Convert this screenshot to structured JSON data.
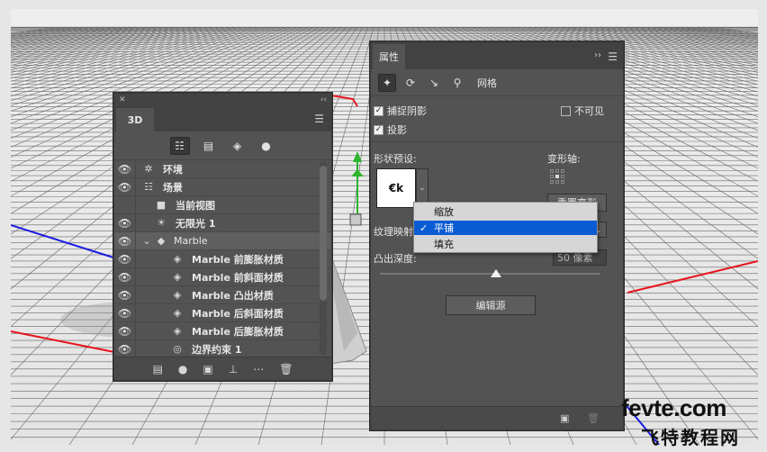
{
  "colors": {
    "panel_bg": "#535353",
    "selection_blue": "#0b5bd3",
    "axis_red": "#e8141c",
    "axis_blue": "#1a1ae0",
    "gizmo_green": "#2db52d"
  },
  "panel_3d": {
    "tab_label": "3D",
    "filter_icons": [
      "scene-filter-icon",
      "mesh-filter-icon",
      "material-filter-icon",
      "light-filter-icon"
    ],
    "layers": [
      {
        "icon": "environment-icon",
        "label": "环境",
        "indent": 0
      },
      {
        "icon": "scene-icon",
        "label": "场景",
        "indent": 0
      },
      {
        "icon": "camera-icon",
        "label": "当前视图",
        "indent": 1
      },
      {
        "icon": "infinite-light-icon",
        "label": "无限光 1",
        "indent": 1
      },
      {
        "icon": "mesh-icon",
        "label": "Marble",
        "indent": 1,
        "selected": true,
        "expanded": true
      },
      {
        "icon": "material-icon",
        "label": "Marble 前膨胀材质",
        "indent": 2
      },
      {
        "icon": "material-icon",
        "label": "Marble 前斜面材质",
        "indent": 2
      },
      {
        "icon": "material-icon",
        "label": "Marble 凸出材质",
        "indent": 2
      },
      {
        "icon": "material-icon",
        "label": "Marble 后斜面材质",
        "indent": 2
      },
      {
        "icon": "material-icon",
        "label": "Marble 后膨胀材质",
        "indent": 2
      },
      {
        "icon": "constraint-icon",
        "label": "边界约束 1",
        "indent": 2
      }
    ]
  },
  "properties": {
    "tab_label": "属性",
    "mesh_label": "网格",
    "catch_shadows": "捕捉阴影",
    "cast_shadows": "投影",
    "invisible": "不可见",
    "shape_preset": "形状预设:",
    "deform_axis": "变形轴:",
    "reset_deform": "重置变形",
    "texture_mapping": "纹理映射:",
    "extrusion_depth": "凸出深度:",
    "depth_value": "50 像素",
    "depth_fraction": 0.53,
    "edit_source": "编辑源"
  },
  "dropdown": {
    "options": [
      {
        "label": "缩放",
        "selected": false
      },
      {
        "label": "平铺",
        "selected": true
      },
      {
        "label": "填充",
        "selected": false
      }
    ]
  },
  "watermark": {
    "line1": "fevte.com",
    "line2": "飞特教程网"
  }
}
